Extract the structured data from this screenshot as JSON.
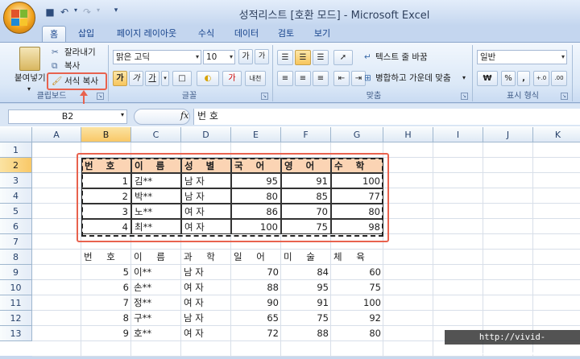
{
  "window": {
    "title": "성적리스트  [호환 모드] - Microsoft Excel"
  },
  "tabs": [
    {
      "label": "홈",
      "active": true
    },
    {
      "label": "삽입"
    },
    {
      "label": "페이지 레이아웃"
    },
    {
      "label": "수식"
    },
    {
      "label": "데이터"
    },
    {
      "label": "검토"
    },
    {
      "label": "보기"
    }
  ],
  "ribbon": {
    "clipboard": {
      "paste_label": "붙여넣기",
      "cut_label": "잘라내기",
      "copy_label": "복사",
      "format_painter_label": "서식 복사",
      "group_label": "클립보드"
    },
    "font": {
      "font_name": "맑은 고딕",
      "font_size": "10",
      "grow_label": "가",
      "shrink_label": "가",
      "bold_label": "가",
      "italic_label": "가",
      "underline_label": "가",
      "font_color_label": "가",
      "phonetic_label": "내천",
      "group_label": "글꼴"
    },
    "alignment": {
      "wrap_label": "텍스트 줄 바꿈",
      "merge_label": "병합하고 가운데 맞춤",
      "group_label": "맞춤"
    },
    "number": {
      "format": "일반",
      "currency_label": "₩",
      "percent_label": "%",
      "comma_label": ",",
      "group_label": "표시 형식"
    }
  },
  "formula_bar": {
    "name_box": "B2",
    "fx_label": "fx",
    "formula": "번 호"
  },
  "columns": [
    "A",
    "B",
    "C",
    "D",
    "E",
    "F",
    "G",
    "H",
    "I",
    "J",
    "K"
  ],
  "rows": [
    "1",
    "2",
    "3",
    "4",
    "5",
    "6",
    "7",
    "8",
    "9",
    "10",
    "11",
    "12",
    "13"
  ],
  "table1": {
    "headers": [
      "번 호",
      "이 름",
      "성 별",
      "국 어",
      "영 어",
      "수 학"
    ],
    "rows": [
      [
        "1",
        "김**",
        "남 자",
        "95",
        "91",
        "100"
      ],
      [
        "2",
        "박**",
        "남 자",
        "80",
        "85",
        "77"
      ],
      [
        "3",
        "노**",
        "여 자",
        "86",
        "70",
        "80"
      ],
      [
        "4",
        "최**",
        "여 자",
        "100",
        "75",
        "98"
      ]
    ]
  },
  "table2": {
    "headers": [
      "번 호",
      "이 름",
      "과 학",
      "일 어",
      "미 술",
      "체 육"
    ],
    "rows": [
      [
        "5",
        "이**",
        "남 자",
        "70",
        "84",
        "60"
      ],
      [
        "6",
        "손**",
        "여 자",
        "88",
        "95",
        "75"
      ],
      [
        "7",
        "정**",
        "여 자",
        "90",
        "91",
        "100"
      ],
      [
        "8",
        "구**",
        "남 자",
        "65",
        "75",
        "92"
      ],
      [
        "9",
        "호**",
        "여 자",
        "72",
        "88",
        "80"
      ]
    ]
  },
  "watermark": "http://vivid-daily.tistory.com",
  "colors": {
    "accent_highlight": "#e8624e",
    "header_fill": "#fbd4b4",
    "selection_header": "#f9c867"
  }
}
